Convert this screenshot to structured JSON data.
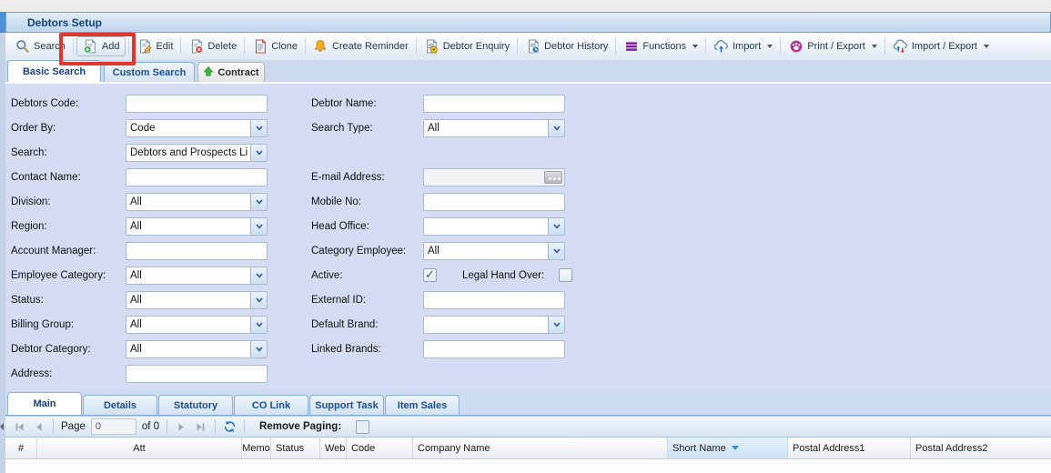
{
  "window": {
    "title": "Debtors Setup"
  },
  "toolbar": {
    "items": [
      {
        "label": "Search",
        "icon": "search-icon"
      },
      {
        "label": "Add",
        "icon": "add-icon",
        "highlighted": true
      },
      {
        "label": "Edit",
        "icon": "edit-icon"
      },
      {
        "label": "Delete",
        "icon": "delete-icon"
      },
      {
        "label": "Clone",
        "icon": "clone-icon"
      },
      {
        "label": "Create Reminder",
        "icon": "bell-icon"
      },
      {
        "label": "Debtor Enquiry",
        "icon": "page-enquiry-icon"
      },
      {
        "label": "Debtor History",
        "icon": "page-clock-icon"
      },
      {
        "label": "Functions",
        "icon": "menu-icon",
        "dropdown": true
      },
      {
        "label": "Import",
        "icon": "cloud-upload-icon",
        "dropdown": true
      },
      {
        "label": "Print / Export",
        "icon": "print-export-icon",
        "dropdown": true
      },
      {
        "label": "Import / Export",
        "icon": "cloud-sync-icon",
        "dropdown": true
      }
    ]
  },
  "search_tabs": {
    "basic": "Basic Search",
    "custom": "Custom Search",
    "contract": "Contract"
  },
  "form": {
    "left": [
      {
        "label": "Debtors Code:",
        "type": "text",
        "value": ""
      },
      {
        "label": "Order By:",
        "type": "select",
        "value": "Code"
      },
      {
        "label": "Search:",
        "type": "select",
        "value": "Debtors and Prospects Li"
      },
      {
        "label": "Contact Name:",
        "type": "text",
        "value": ""
      },
      {
        "label": "Division:",
        "type": "select",
        "value": "All"
      },
      {
        "label": "Region:",
        "type": "select",
        "value": "All"
      },
      {
        "label": "Account Manager:",
        "type": "text",
        "value": ""
      },
      {
        "label": "Employee Category:",
        "type": "select",
        "value": "All"
      },
      {
        "label": "Status:",
        "type": "select",
        "value": "All"
      },
      {
        "label": "Billing Group:",
        "type": "select",
        "value": "All"
      },
      {
        "label": "Debtor Category:",
        "type": "select",
        "value": "All"
      },
      {
        "label": "Address:",
        "type": "text",
        "value": ""
      }
    ],
    "right": [
      {
        "label": "Debtor Name:",
        "type": "text",
        "value": ""
      },
      {
        "label": "Search Type:",
        "type": "select",
        "value": "All"
      },
      {
        "label": "E-mail Address:",
        "type": "text-button",
        "value": "",
        "button": "..."
      },
      {
        "label": "Mobile No:",
        "type": "text",
        "value": ""
      },
      {
        "label": "Head Office:",
        "type": "select",
        "value": ""
      },
      {
        "label": "Category Employee:",
        "type": "select",
        "value": "All"
      },
      {
        "label": "Active:",
        "type": "checkbox",
        "checked": true,
        "label2": "Legal Hand Over:",
        "checked2": false
      },
      {
        "label": "External ID:",
        "type": "text",
        "value": ""
      },
      {
        "label": "Default Brand:",
        "type": "select",
        "value": ""
      },
      {
        "label": "Linked Brands:",
        "type": "text",
        "value": ""
      }
    ]
  },
  "bottom_tabs": [
    "Main",
    "Details",
    "Statutory",
    "CO Link",
    "Support Task",
    "Item Sales"
  ],
  "pager": {
    "page_label": "Page",
    "page_value": "0",
    "of_label": "of 0",
    "remove_paging_label": "Remove Paging:",
    "remove_paging_checked": false
  },
  "grid": {
    "columns": [
      "#",
      "Att",
      "Memo",
      "Status",
      "Web:",
      "Code",
      "Company Name",
      "Short Name",
      "Postal Address1",
      "Postal Address2"
    ],
    "sort": {
      "column": "Short Name",
      "direction": "desc"
    },
    "rows": []
  },
  "colors": {
    "highlight_box": "#e2362a",
    "title_text": "#16437e",
    "form_background": "#d4ddf4",
    "accent_blue": "#2e6bc0"
  }
}
